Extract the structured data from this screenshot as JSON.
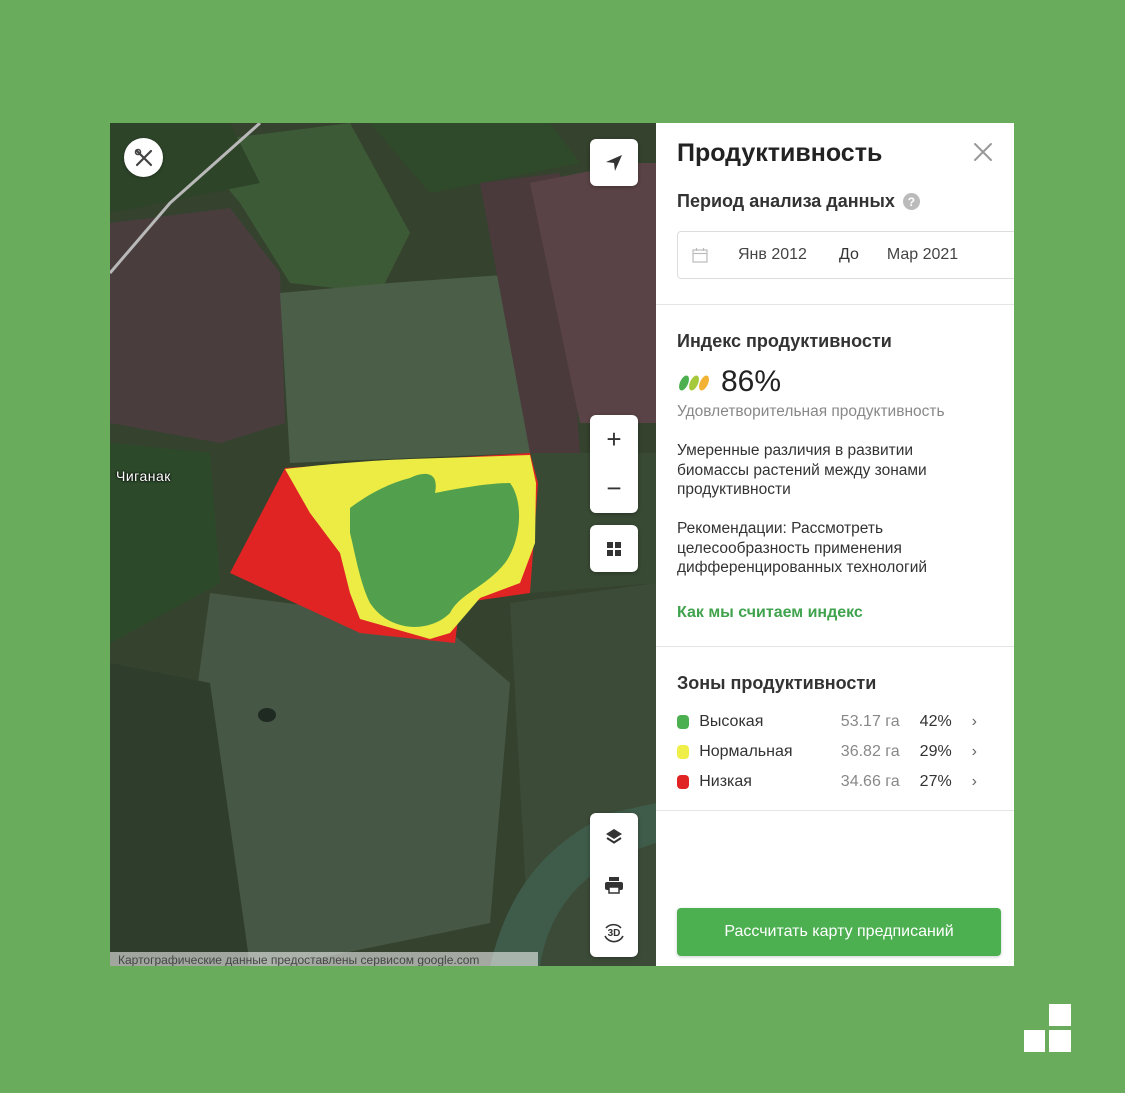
{
  "map": {
    "village_label": "Чиганак",
    "attribution": "Картографические данные предоставлены сервисом google.com",
    "controls": {
      "tools": "tools-icon",
      "locate": "navigation-arrow-icon",
      "zoom_in": "+",
      "zoom_out": "−",
      "grid": "grid-icon",
      "layers": "layers-icon",
      "print": "print-icon",
      "view3d": "3D"
    },
    "zone_colors": {
      "high": "#4caf50",
      "normal": "#ecec45",
      "low": "#e02424"
    }
  },
  "panel": {
    "title": "Продуктивность",
    "period_label": "Период анализа данных",
    "help_glyph": "?",
    "date_from": "Янв 2012",
    "date_sep": "До",
    "date_to": "Мар 2021",
    "index_heading": "Индекс продуктивности",
    "index_value": "86%",
    "index_description": "Удовлетворительная продуктивность",
    "note": "Умеренные различия в развитии биомассы растений между зонами продуктивности",
    "recommendation": "Рекомендации: Рассмотреть целесообразность применения дифференцированных технологий",
    "how_link": "Как мы считаем индекс",
    "zones_heading": "Зоны продуктивности",
    "zones": [
      {
        "name": "Высокая",
        "area": "53.17 га",
        "percent": "42%",
        "color": "#4caf50"
      },
      {
        "name": "Нормальная",
        "area": "36.82 га",
        "percent": "29%",
        "color": "#f0ef4a"
      },
      {
        "name": "Низкая",
        "area": "34.66 га",
        "percent": "27%",
        "color": "#e02424"
      }
    ],
    "action_button": "Рассчитать карту предписаний"
  }
}
